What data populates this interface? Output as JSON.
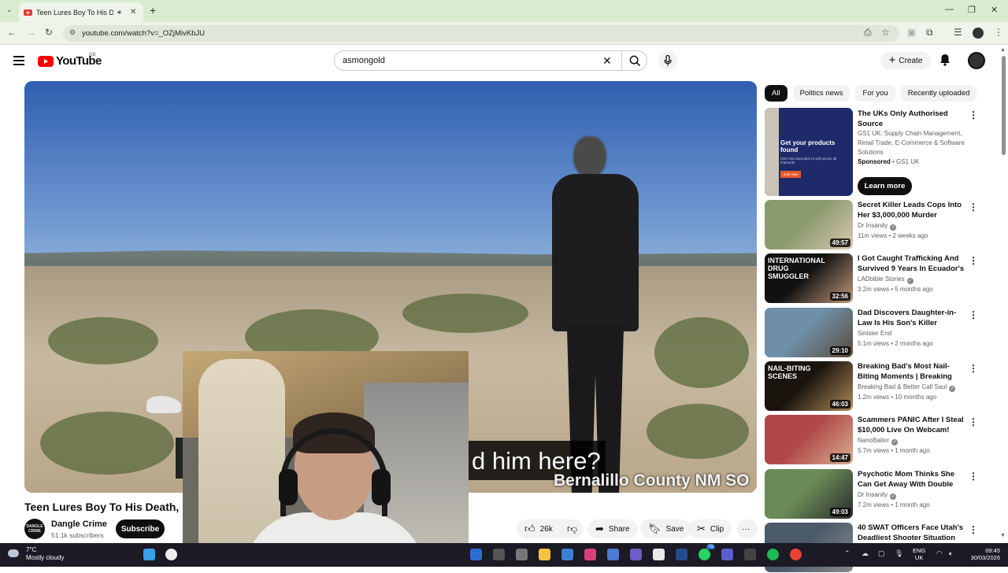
{
  "browser": {
    "tab_title": "Teen Lures Boy To His Death",
    "url": "youtube.com/watch?v=_OZjMivKbJU"
  },
  "youtube": {
    "logo_text": "YouTube",
    "country_code": "GB",
    "search_query": "asmongold",
    "create_label": "Create"
  },
  "video": {
    "caption_text": "d him here?",
    "location_overlay": "Bernalillo County NM SO",
    "title": "Teen Lures Boy To His Death, Thir",
    "channel_name": "Dangle Crime",
    "channel_avatar_text": "DANGLE CRIME",
    "subscribers": "51.1k subscribers",
    "subscribe_label": "Subscribe",
    "likes": "26k",
    "share_label": "Share",
    "save_label": "Save",
    "clip_label": "Clip",
    "more_label": "···"
  },
  "chips": [
    "All",
    "Politics news",
    "For you",
    "Recently uploaded"
  ],
  "ad": {
    "thumb_headline": "Get your products found",
    "thumb_sub": "Use GS1 barcodes to sell across all channels",
    "thumb_button": "Join now",
    "title": "The UKs Only Authorised Source",
    "description": "GS1 UK: Supply Chain Management, Retail Trade, E-Commerce & Software Solutions",
    "sponsored": "Sponsored",
    "advertiser": "GS1 UK",
    "cta": "Learn more"
  },
  "recommendations": [
    {
      "title": "Secret Killer Leads Cops Into Her $3,000,000 Murder Mansion",
      "channel": "Dr Insanity",
      "verified": true,
      "meta": "11m views • 2 weeks ago",
      "duration": "49:57",
      "thumb_colors": [
        "#8a9a6e",
        "#d9c9b0"
      ]
    },
    {
      "title": "I Got Caught Trafficking And Survived 9 Years In Ecuador's ...",
      "channel": "LADbible Stories",
      "verified": true,
      "meta": "3.2m views • 5 months ago",
      "duration": "32:56",
      "thumb_colors": [
        "#111111",
        "#c49a7d"
      ],
      "thumb_text": "INTERNATIONAL DRUG SMUGGLER"
    },
    {
      "title": "Dad Discovers Daughter-in-Law Is His Son's Killer",
      "channel": "Sinister End",
      "verified": false,
      "meta": "5.1m views • 2 months ago",
      "duration": "29:10",
      "thumb_colors": [
        "#6f8fa8",
        "#5a4a3a"
      ]
    },
    {
      "title": "Breaking Bad's Most Nail-Biting Moments | Breaking Bad",
      "channel": "Breaking Bad & Better Call Saul",
      "verified": true,
      "meta": "1.2m views • 10 months ago",
      "duration": "46:03",
      "thumb_colors": [
        "#1a140e",
        "#b08a5a"
      ],
      "thumb_text": "NAIL-BITING SCENES"
    },
    {
      "title": "Scammers PANIC After I Steal $10,000 Live On Webcam!",
      "channel": "NanoBaiter",
      "verified": true,
      "meta": "5.7m views • 1 month ago",
      "duration": "14:47",
      "thumb_colors": [
        "#b04848",
        "#d8b092"
      ]
    },
    {
      "title": "Psychotic Mom Thinks She Can Get Away With Double Murder",
      "channel": "Dr Insanity",
      "verified": true,
      "meta": "7.2m views • 1 month ago",
      "duration": "49:03",
      "thumb_colors": [
        "#6a8a58",
        "#2a2a2a"
      ]
    },
    {
      "title": "40 SWAT Officers Face Utah's Deadliest Shooter Situation",
      "channel": "",
      "verified": false,
      "meta": "",
      "duration": "",
      "thumb_colors": [
        "#4a5a6a",
        "#8a8a8a"
      ]
    }
  ],
  "taskbar": {
    "temperature": "7°C",
    "weather": "Mostly cloudy",
    "lang_top": "ENG",
    "lang_bottom": "UK",
    "time": "09:45",
    "date": "30/03/2026",
    "badge": "79"
  },
  "colors": {
    "tab_bar": "#d9ebd0",
    "yt_red": "#ff0000",
    "dark": "#0f0f0f"
  }
}
